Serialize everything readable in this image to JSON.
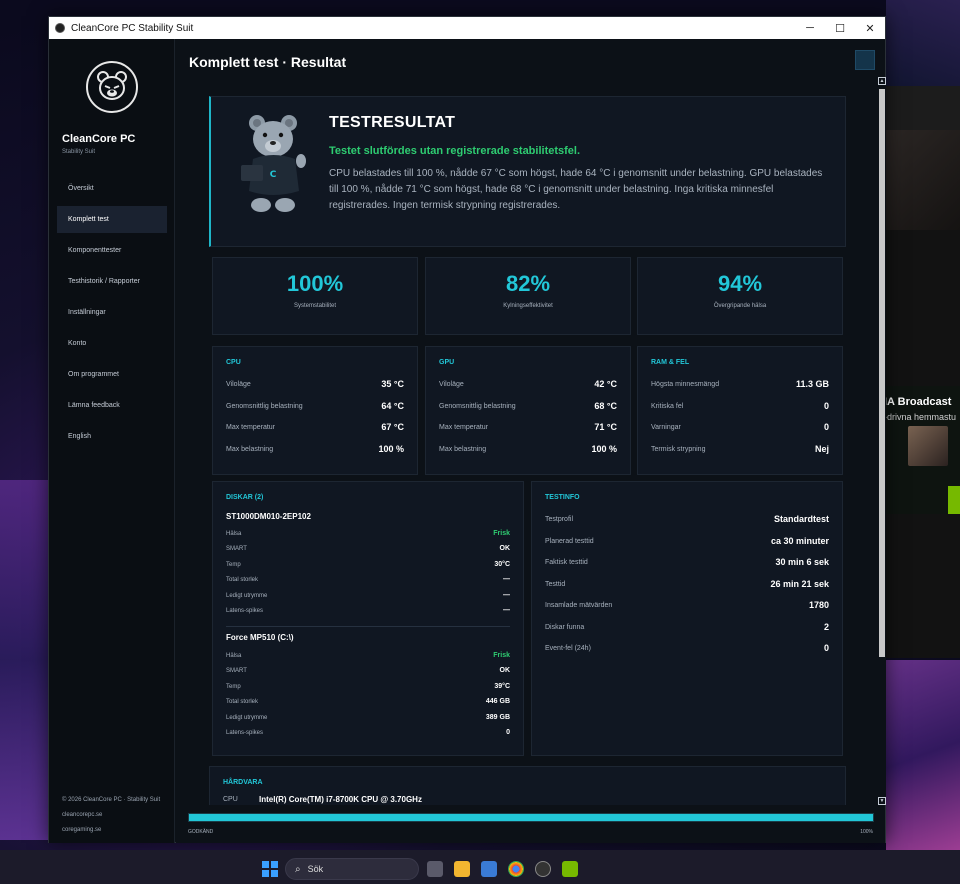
{
  "window": {
    "title": "CleanCore PC Stability Suit",
    "controls": {
      "minimize": "─",
      "maximize": "☐",
      "close": "✕"
    }
  },
  "sidebar": {
    "brand_name": "CleanCore PC",
    "brand_sub": "Stability Suit",
    "items": [
      {
        "label": "Översikt",
        "active": false
      },
      {
        "label": "Komplett test",
        "active": true
      },
      {
        "label": "Komponenttester",
        "active": false
      },
      {
        "label": "Testhistorik / Rapporter",
        "active": false
      },
      {
        "label": "Inställningar",
        "active": false
      },
      {
        "label": "Konto",
        "active": false
      },
      {
        "label": "Om programmet",
        "active": false
      },
      {
        "label": "Lämna feedback",
        "active": false
      },
      {
        "label": "English",
        "active": false
      }
    ],
    "footer": {
      "copyright": "© 2026 CleanCore PC · Stability Suit",
      "link1": "cleancorepc.se",
      "link2": "coregaming.se"
    }
  },
  "main": {
    "page_title": "Komplett test · Resultat",
    "result": {
      "title": "TESTRESULTAT",
      "subtitle": "Testet slutfördes utan registrerade stabilitetsfel.",
      "description": "CPU belastades till 100 %, nådde 67 °C som högst, hade 64 °C i genomsnitt under belastning. GPU belastades till 100 %, nådde 71 °C som högst, hade 68 °C i genomsnitt under belastning. Inga kritiska minnesfel registrerades. Ingen termisk strypning registrerades."
    },
    "stats": [
      {
        "value": "100%",
        "label": "Systemstabilitet"
      },
      {
        "value": "82%",
        "label": "Kylningseffektivitet"
      },
      {
        "value": "94%",
        "label": "Övergripande hälsa"
      }
    ],
    "cpu": {
      "title": "CPU",
      "rows": [
        {
          "k": "Viloläge",
          "v": "35 °C"
        },
        {
          "k": "Genomsnittlig belastning",
          "v": "64 °C"
        },
        {
          "k": "Max temperatur",
          "v": "67 °C"
        },
        {
          "k": "Max belastning",
          "v": "100 %"
        }
      ]
    },
    "gpu": {
      "title": "GPU",
      "rows": [
        {
          "k": "Viloläge",
          "v": "42 °C"
        },
        {
          "k": "Genomsnittlig belastning",
          "v": "68 °C"
        },
        {
          "k": "Max temperatur",
          "v": "71 °C"
        },
        {
          "k": "Max belastning",
          "v": "100 %"
        }
      ]
    },
    "ram": {
      "title": "RAM & FEL",
      "rows": [
        {
          "k": "Högsta minnesmängd",
          "v": "11.3 GB"
        },
        {
          "k": "Kritiska fel",
          "v": "0"
        },
        {
          "k": "Varningar",
          "v": "0"
        },
        {
          "k": "Termisk strypning",
          "v": "Nej"
        }
      ]
    },
    "disks": {
      "title": "DISKAR (2)",
      "disk1": {
        "name": "ST1000DM010-2EP102",
        "rows": [
          {
            "k": "Hälsa",
            "v": "Frisk"
          },
          {
            "k": "SMART",
            "v": "OK"
          },
          {
            "k": "Temp",
            "v": "30°C"
          },
          {
            "k": "Total storlek",
            "v": "—"
          },
          {
            "k": "Ledigt utrymme",
            "v": "—"
          },
          {
            "k": "Latens-spikes",
            "v": "—"
          }
        ]
      },
      "disk2": {
        "name": "Force MP510 (C:\\)",
        "rows": [
          {
            "k": "Hälsa",
            "v": "Frisk"
          },
          {
            "k": "SMART",
            "v": "OK"
          },
          {
            "k": "Temp",
            "v": "39°C"
          },
          {
            "k": "Total storlek",
            "v": "446 GB"
          },
          {
            "k": "Ledigt utrymme",
            "v": "389 GB"
          },
          {
            "k": "Latens-spikes",
            "v": "0"
          }
        ]
      }
    },
    "testinfo": {
      "title": "TESTINFO",
      "rows": [
        {
          "k": "Testprofil",
          "v": "Standardtest"
        },
        {
          "k": "Planerad testtid",
          "v": "ca 30 minuter"
        },
        {
          "k": "Faktisk testtid",
          "v": "30 min 6 sek"
        },
        {
          "k": "Testtid",
          "v": "26 min 21 sek"
        },
        {
          "k": "Insamlade mätvärden",
          "v": "1780"
        },
        {
          "k": "Diskar funna",
          "v": "2"
        },
        {
          "k": "Event-fel (24h)",
          "v": "0"
        }
      ]
    },
    "hardware": {
      "title": "HÅRDVARA",
      "cpu_label": "CPU",
      "cpu_value": "Intel(R) Core(TM) i7-8700K CPU @ 3.70GHz"
    },
    "progress": {
      "label": "GODKÄND",
      "percent_text": "100%",
      "value": 1.0
    }
  },
  "background_window": {
    "promo_title": "IA Broadcast",
    "promo_sub": "-drivna hemmastu"
  },
  "taskbar": {
    "search_placeholder": "Sök"
  },
  "colors": {
    "accent": "#22c7d8",
    "success": "#2ecc71",
    "card_bg": "#101722",
    "app_bg": "#0c1117"
  }
}
